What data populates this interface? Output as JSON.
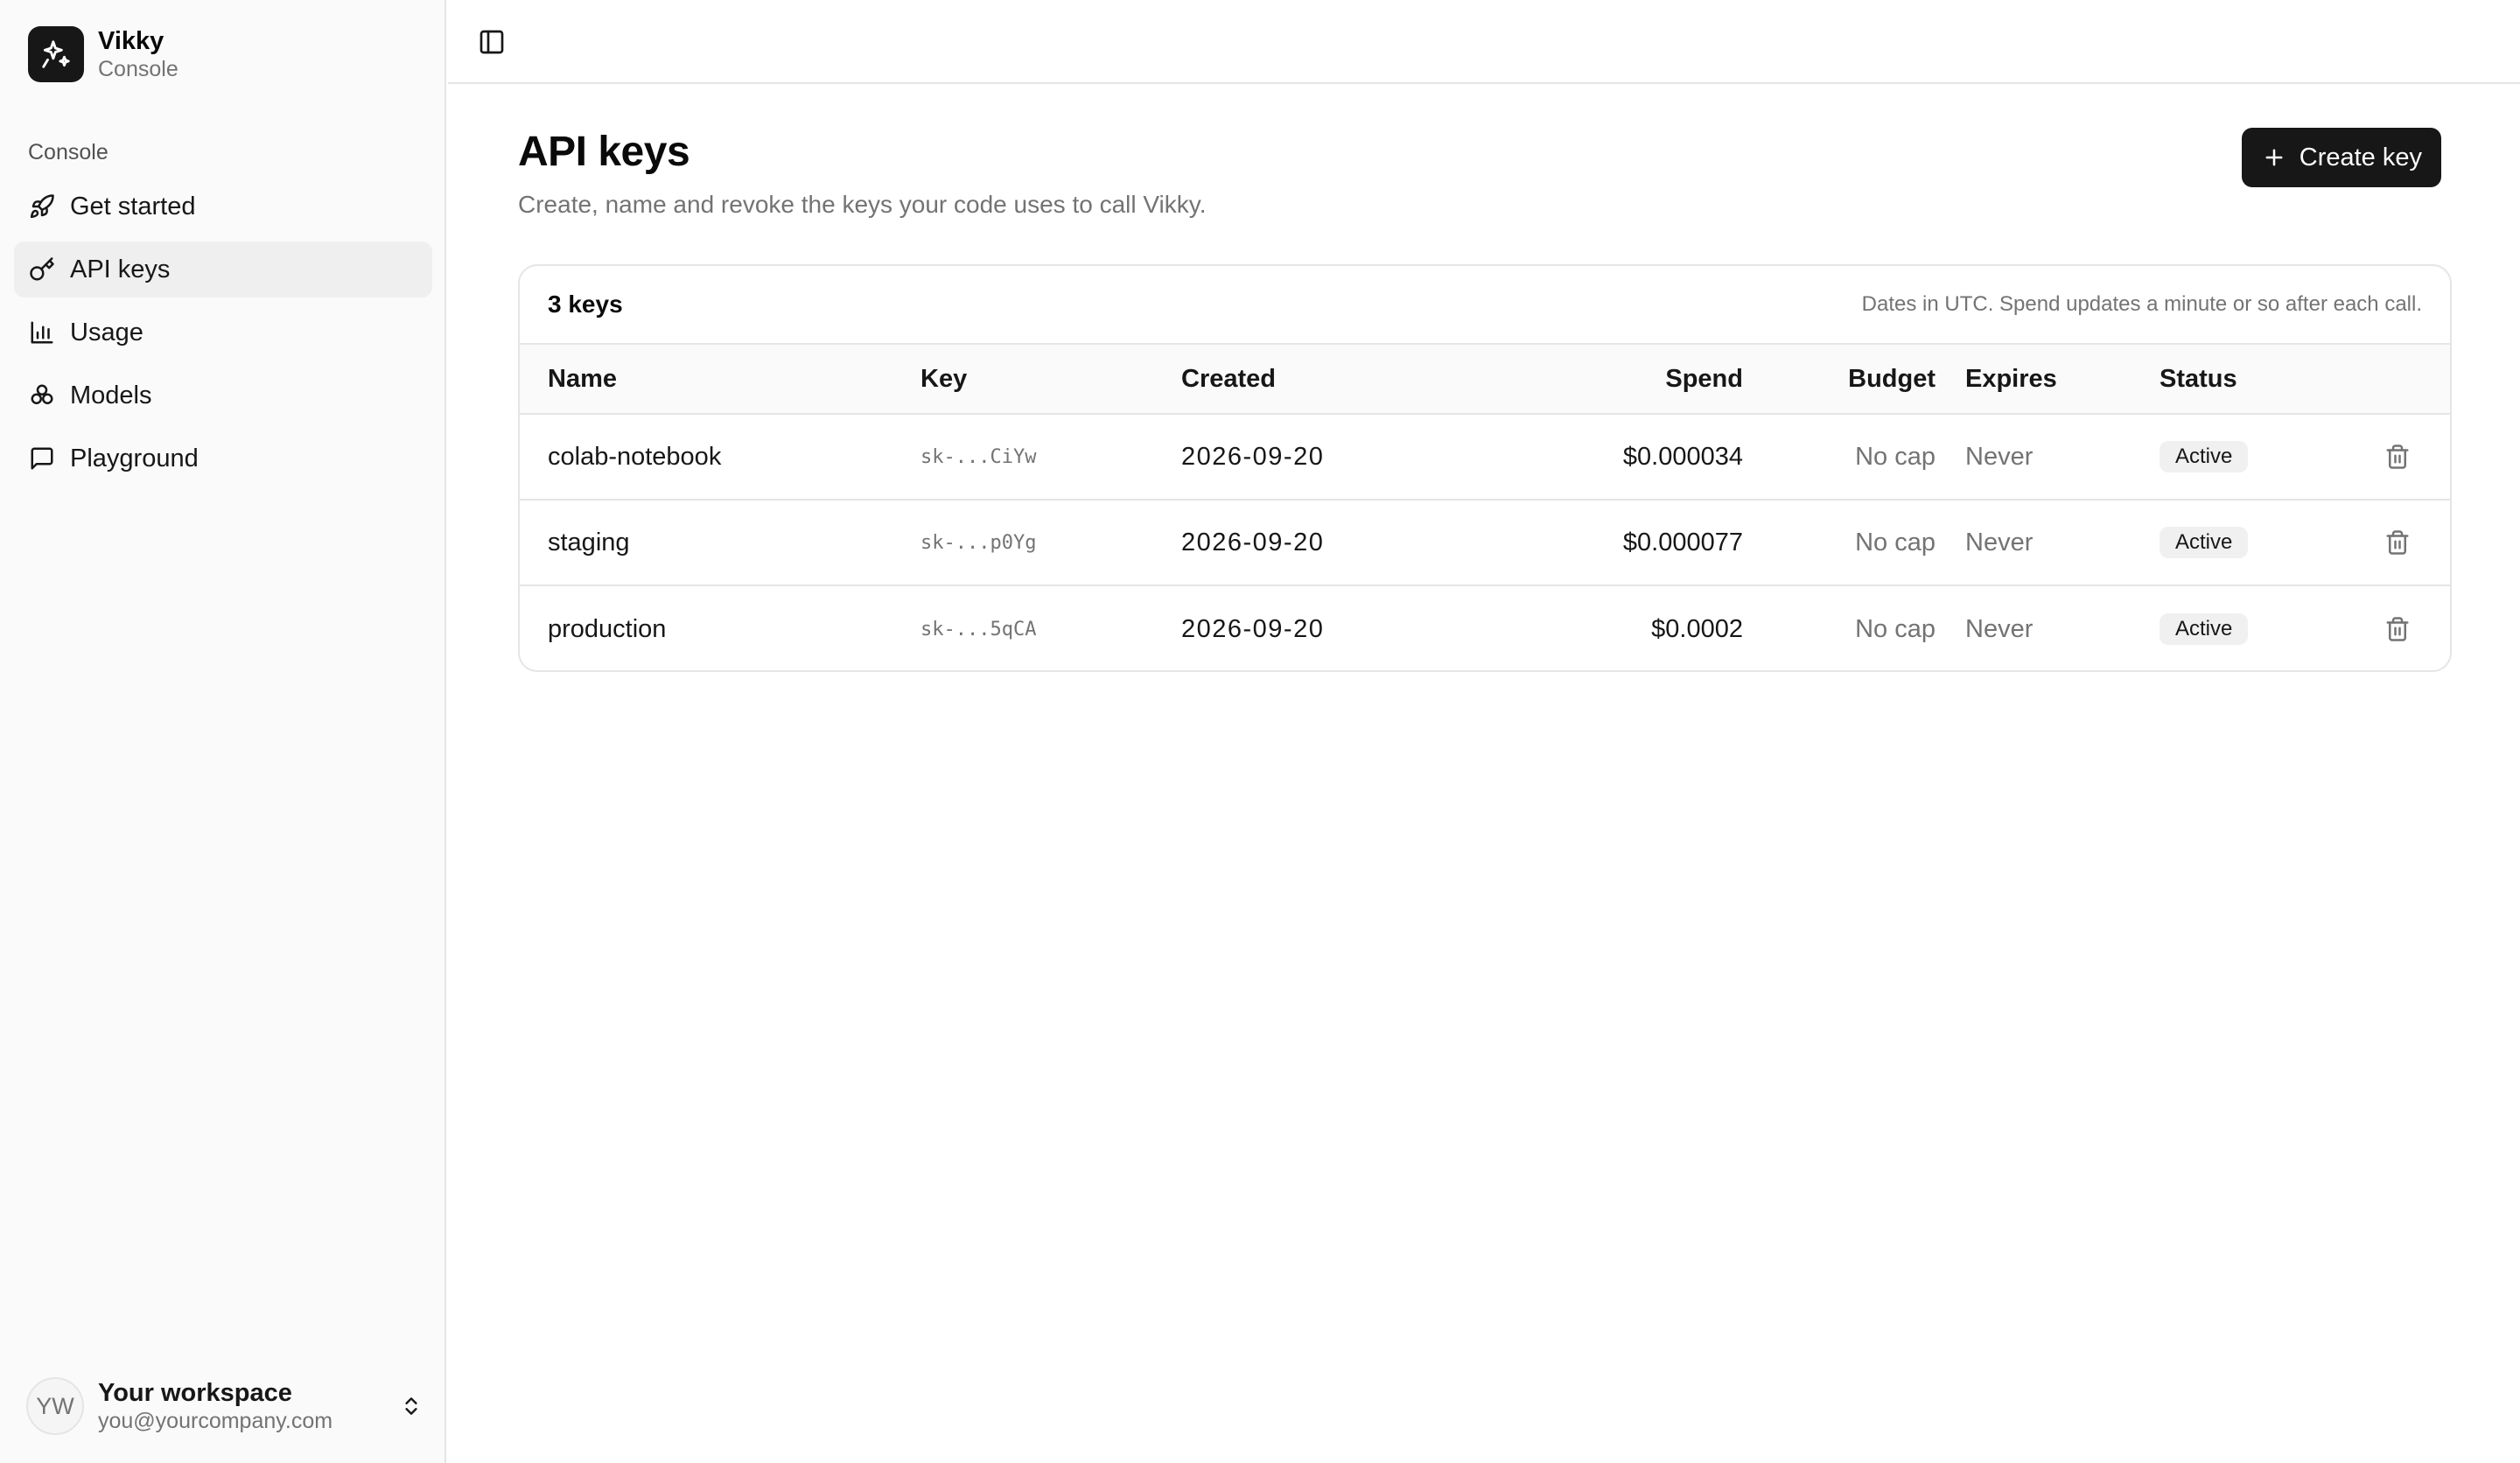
{
  "brand": {
    "name": "Vikky",
    "subtitle": "Console"
  },
  "sidebar": {
    "group_label": "Console",
    "items": [
      {
        "label": "Get started",
        "icon": "rocket-icon",
        "active": false
      },
      {
        "label": "API keys",
        "icon": "key-icon",
        "active": true
      },
      {
        "label": "Usage",
        "icon": "bar-chart-icon",
        "active": false
      },
      {
        "label": "Models",
        "icon": "boxes-icon",
        "active": false
      },
      {
        "label": "Playground",
        "icon": "message-square-icon",
        "active": false
      }
    ],
    "workspace": {
      "initials": "YW",
      "name": "Your workspace",
      "email": "you@yourcompany.com"
    }
  },
  "header": {
    "toggle_icon": "sidebar-toggle-icon"
  },
  "main": {
    "title": "API keys",
    "subtitle": "Create, name and revoke the keys your code uses to call Vikky.",
    "create_button": "Create key",
    "count_label": "3 keys",
    "note": "Dates in UTC. Spend updates a minute or so after each call.",
    "columns": {
      "name": "Name",
      "key": "Key",
      "created": "Created",
      "spend": "Spend",
      "budget": "Budget",
      "expires": "Expires",
      "status": "Status"
    },
    "rows": [
      {
        "name": "colab-notebook",
        "key": "sk-...CiYw",
        "created": "2026-09-20",
        "spend": "$0.000034",
        "budget": "No cap",
        "expires": "Never",
        "status": "Active"
      },
      {
        "name": "staging",
        "key": "sk-...p0Yg",
        "created": "2026-09-20",
        "spend": "$0.000077",
        "budget": "No cap",
        "expires": "Never",
        "status": "Active"
      },
      {
        "name": "production",
        "key": "sk-...5qCA",
        "created": "2026-09-20",
        "spend": "$0.0002",
        "budget": "No cap",
        "expires": "Never",
        "status": "Active"
      }
    ]
  },
  "colors": {
    "primary": "#171717",
    "muted": "#737373",
    "border": "#e5e5e5",
    "sidebar_bg": "#fafafa",
    "badge_bg": "#f0f0f0"
  }
}
